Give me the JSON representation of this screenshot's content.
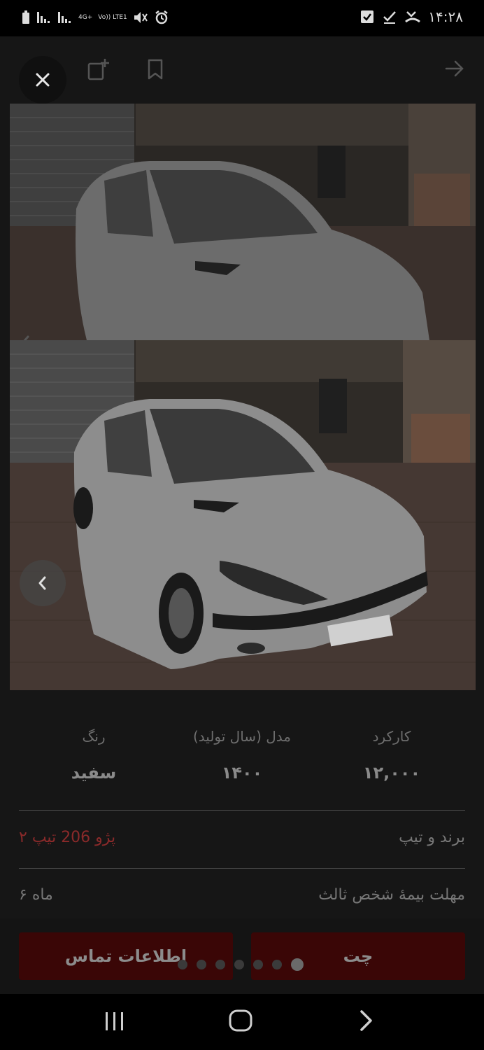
{
  "status_bar": {
    "time": "۱۴:۲۸",
    "network_label_1": "4G+",
    "network_label_2": "Vo)) LTE1"
  },
  "details": {
    "mileage_label": "کارکرد",
    "mileage_value": "۱۲,۰۰۰",
    "model_label": "مدل (سال تولید)",
    "model_value": "۱۴۰۰",
    "color_label": "رنگ",
    "color_value": "سفید",
    "brand_label": "برند و تیپ",
    "brand_value": "پژو 206 تیپ ۲",
    "insurance_label": "مهلت بیمهٔ شخص ثالث",
    "insurance_value": "۶ ماه"
  },
  "actions": {
    "chat_label": "چت",
    "contact_label": "اطلاعات تماس"
  },
  "gallery": {
    "dot_count": 7,
    "active_dot_index": 6
  },
  "colors": {
    "action_button": "#3a0606",
    "brand_value": "#8a2a2a"
  }
}
